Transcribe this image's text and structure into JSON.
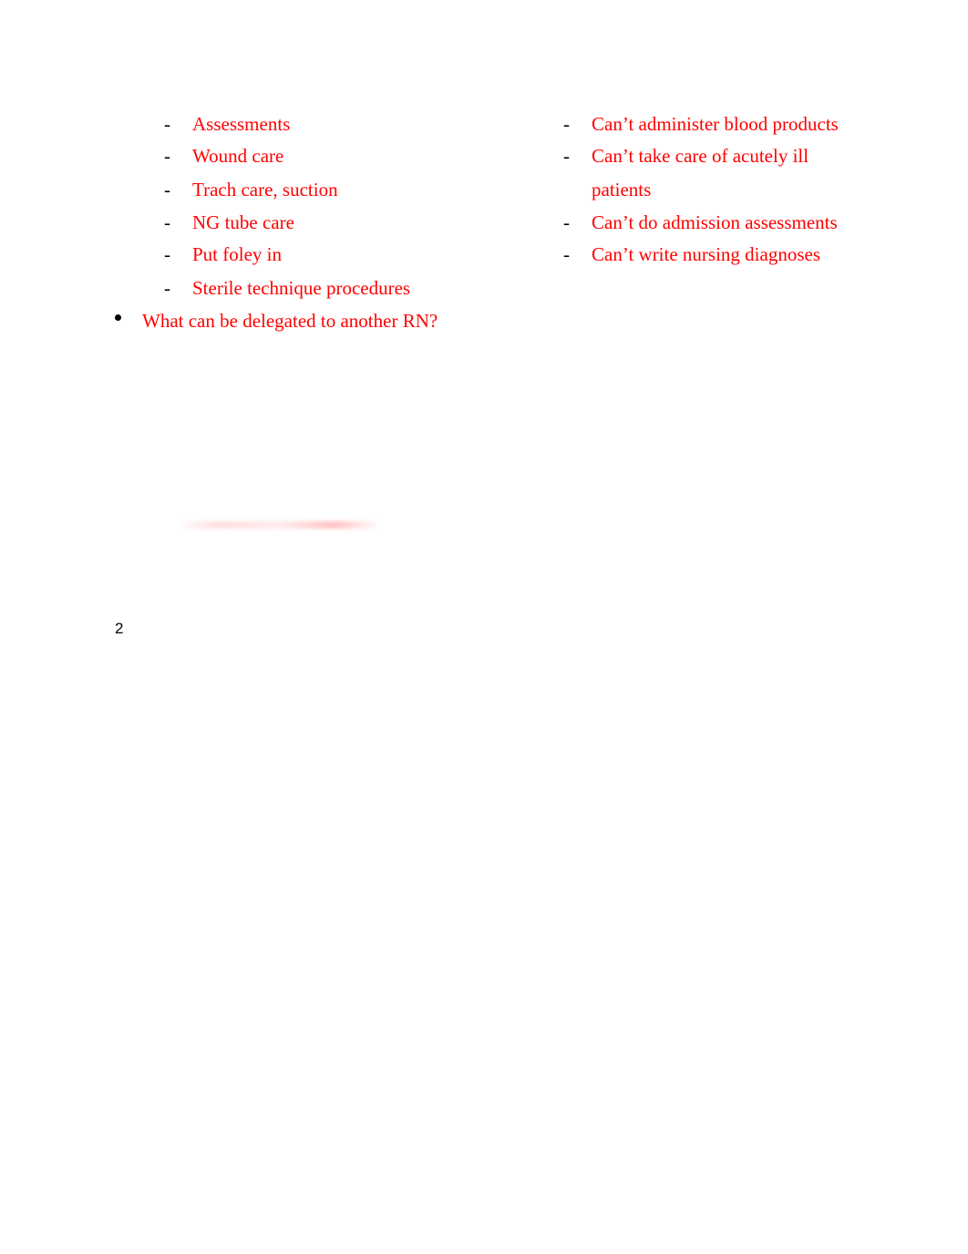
{
  "document": {
    "left_column": {
      "items": [
        {
          "marker": "-",
          "text": "Assessments"
        },
        {
          "marker": "-",
          "text": "Wound care"
        },
        {
          "marker": "-",
          "text": "Trach care, suction"
        },
        {
          "marker": "-",
          "text": "NG tube care"
        },
        {
          "marker": "-",
          "text": "Put foley in"
        },
        {
          "marker": "-",
          "text": "Sterile technique procedures"
        }
      ]
    },
    "right_column": {
      "items": [
        {
          "marker": "-",
          "text": "Can’t administer blood products"
        },
        {
          "marker": "-",
          "text": "Can’t take care of acutely ill",
          "continuation": "patients"
        },
        {
          "marker": "-",
          "text": "Can’t do admission assessments"
        },
        {
          "marker": "-",
          "text": "Can’t write nursing diagnoses"
        }
      ]
    },
    "bullet_question": "What can be delegated to another RN?",
    "page_number": "2",
    "colors": {
      "answer_text": "#ff0000",
      "marker": "#000000"
    }
  }
}
